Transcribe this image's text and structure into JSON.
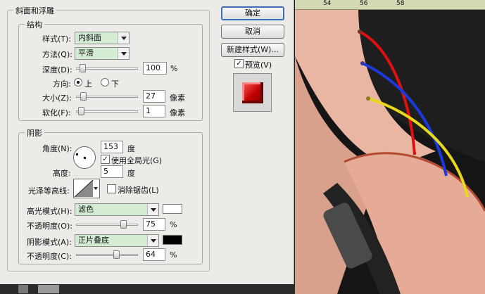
{
  "bevel_title": "斜面和浮雕",
  "structure": {
    "title": "结构",
    "style_label": "样式(T):",
    "style_value": "内斜面",
    "technique_label": "方法(Q):",
    "technique_value": "平滑",
    "depth_label": "深度(D):",
    "depth_value": "100",
    "depth_unit": "%",
    "direction_label": "方向:",
    "dir_up": "上",
    "dir_down": "下",
    "size_label": "大小(Z):",
    "size_value": "27",
    "size_unit": "像素",
    "soften_label": "软化(F):",
    "soften_value": "1",
    "soften_unit": "像素"
  },
  "shading": {
    "title": "阴影",
    "angle_label": "角度(N):",
    "angle_value": "153",
    "angle_unit": "度",
    "global_light_label": "使用全局光(G)",
    "altitude_label": "高度:",
    "altitude_value": "5",
    "altitude_unit": "度",
    "gloss_label": "光泽等高线:",
    "antialias_label": "消除锯齿(L)",
    "highlight_mode_label": "高光模式(H):",
    "highlight_mode_value": "滤色",
    "opacity1_label": "不透明度(O):",
    "opacity1_value": "75",
    "opacity1_unit": "%",
    "shadow_mode_label": "阴影模式(A):",
    "shadow_mode_value": "正片叠底",
    "opacity2_label": "不透明度(C):",
    "opacity2_value": "64",
    "opacity2_unit": "%",
    "highlight_color": "#ffffff",
    "shadow_color": "#000000"
  },
  "buttons": {
    "ok": "确定",
    "cancel": "取消",
    "new_style": "新建样式(W)...",
    "preview": "预览(V)"
  },
  "ruler": {
    "ticks": [
      "54",
      "56",
      "58"
    ]
  }
}
